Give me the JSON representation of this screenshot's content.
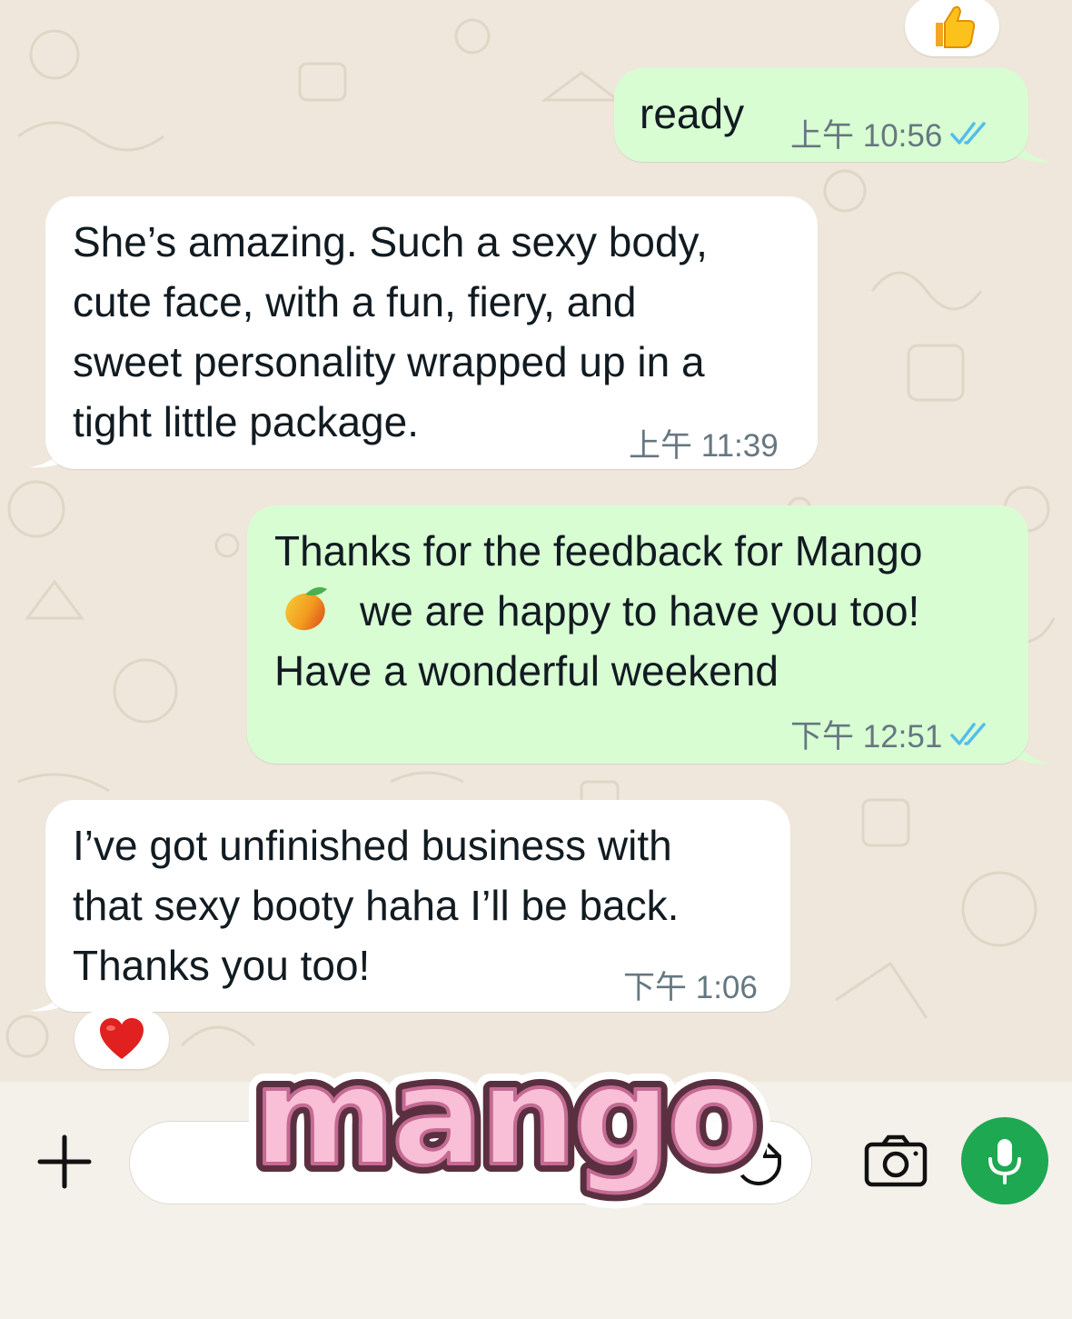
{
  "chat": {
    "messages": [
      {
        "direction": "outgoing",
        "text": "ready",
        "time": "上午 10:56",
        "status": "read",
        "reaction": "thumbs-up"
      },
      {
        "direction": "incoming",
        "text": "She’s amazing. Such a sexy body,\ncute face, with a fun, fiery, and\nsweet personality wrapped up in a\ntight little package.",
        "time": "上午 11:39"
      },
      {
        "direction": "outgoing",
        "line1": "Thanks for the feedback for Mango",
        "line2": "we are happy to have you too!",
        "line3": "Have a wonderful weekend",
        "emoji": "mango",
        "time": "下午 12:51",
        "status": "read"
      },
      {
        "direction": "incoming",
        "text": "I’ve got unfinished business with\nthat sexy booty haha I’ll be back.\nThanks you too!",
        "time": "下午 1:06",
        "reaction": "red-heart"
      }
    ]
  },
  "composer": {
    "attach_icon": "plus-icon",
    "sticker_icon": "sticker-icon",
    "camera_icon": "camera-icon",
    "mic_icon": "microphone-icon"
  },
  "watermark": {
    "text": "mango"
  },
  "colors": {
    "outgoing_bubble": "#d9fdd3",
    "incoming_bubble": "#ffffff",
    "read_ticks": "#53bdeb",
    "mic_button": "#1da851",
    "chat_background": "#efe7db",
    "watermark_fill": "#f8bfd6",
    "watermark_outline": "#5a3040"
  }
}
